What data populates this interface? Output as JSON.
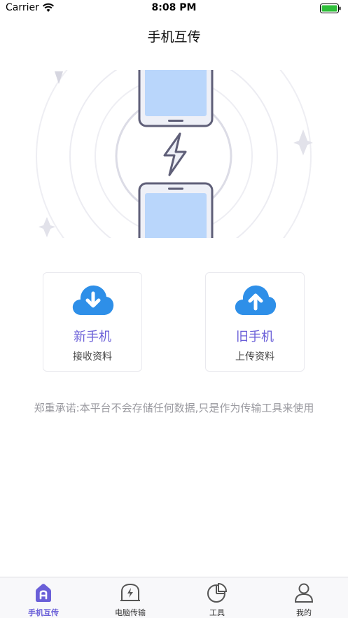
{
  "status_bar": {
    "carrier": "Carrier",
    "time": "8:08 PM"
  },
  "nav": {
    "title": "手机互传"
  },
  "cards": {
    "new_phone": {
      "title": "新手机",
      "subtitle": "接收资料",
      "icon": "cloud-download-icon"
    },
    "old_phone": {
      "title": "旧手机",
      "subtitle": "上传资料",
      "icon": "cloud-upload-icon"
    }
  },
  "notice": "郑重承诺:本平台不会存储任何数据,只是作为传输工具来使用",
  "tabs": [
    {
      "label": "手机互传",
      "icon": "home-a-icon",
      "active": true
    },
    {
      "label": "电脑传输",
      "icon": "computer-transfer-icon",
      "active": false
    },
    {
      "label": "工具",
      "icon": "pie-chart-icon",
      "active": false
    },
    {
      "label": "我的",
      "icon": "user-icon",
      "active": false
    }
  ],
  "colors": {
    "accent": "#6a5fd8",
    "cloud": "#2e8fe8",
    "notice": "#9a9aa0"
  }
}
